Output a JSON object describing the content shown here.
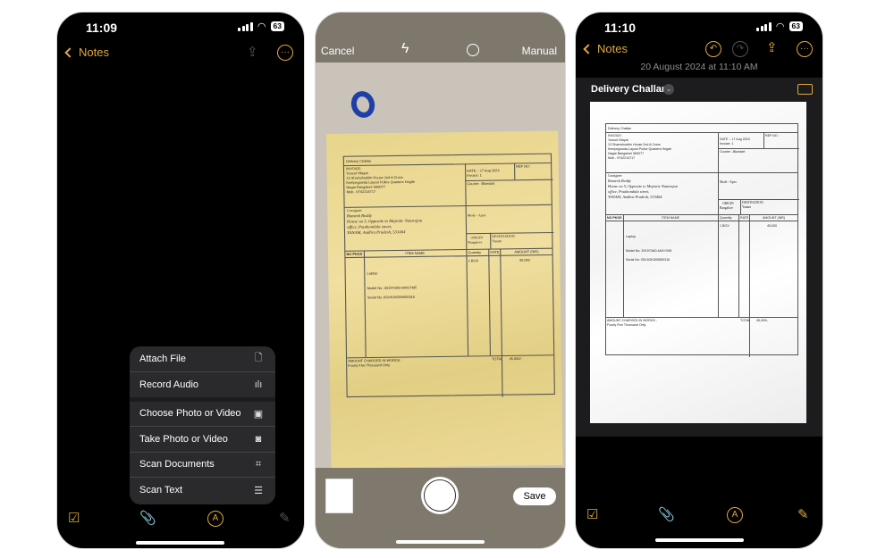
{
  "phone1": {
    "time": "11:09",
    "battery": "63",
    "back_label": "Notes",
    "menu": [
      {
        "label": "Attach File",
        "icon": "document-icon"
      },
      {
        "label": "Record Audio",
        "icon": "waveform-icon"
      },
      {
        "label": "Choose Photo or Video",
        "icon": "photo-library-icon"
      },
      {
        "label": "Take Photo or Video",
        "icon": "camera-icon"
      },
      {
        "label": "Scan Documents",
        "icon": "scan-document-icon"
      },
      {
        "label": "Scan Text",
        "icon": "scan-text-icon"
      }
    ]
  },
  "phone2": {
    "cancel": "Cancel",
    "mode": "Manual",
    "save": "Save"
  },
  "phone3": {
    "time": "11:10",
    "battery": "63",
    "back_label": "Notes",
    "date": "20 August 2024 at 11:10 AM",
    "scan_title": "Delivery Challan"
  },
  "doc": {
    "title": "Delivery Challan",
    "invoice_label": "INVOICE:",
    "sender": [
      "Yousuf Vilayat",
      "13 Shamshuddin House 2nd A Cross",
      "Kempegowda Layout Police Quarters Hegde",
      "Nagar Bangalore 560077",
      "Mob - 9742214717"
    ],
    "date": "DATE :- 17 Aug 2024",
    "invoice_no": "Invoice: 1",
    "ref_no": "REF NO :",
    "courier": "Courier: -Bluedart",
    "consignee_label": "Consignee:",
    "consignee": [
      "Ramesh Reddy",
      "House no 5, Opposite to Majestic Natarajan",
      "office, Pouthondala street,",
      "YANAM, Andhra Pradesh, 533464"
    ],
    "mode": "Mode - Apex",
    "origin": "ORIGIN",
    "origin_city": "Bangalore",
    "destination": "DESTINATION",
    "destination_city": "Yanam",
    "headers": [
      "NO PKGS",
      "ITEM NAME",
      "Quantity",
      "RATE",
      "AMOUNT (INR)"
    ],
    "qty": "1 BOX",
    "amount": "45,000",
    "item": "Laptop",
    "model": "Model No: 3S1970AD-M4/1YM5",
    "serial": "Serial No: 0SV4OK5098S0316",
    "words_label": "AMOUNT CHARGED IN WORDS :",
    "words": "Fourty Five Thousand Only",
    "total_label": "TOTAL",
    "total": "45,000/-"
  },
  "colors": {
    "accent": "#e0a93a",
    "menu_bg": "#2a2a2c"
  }
}
